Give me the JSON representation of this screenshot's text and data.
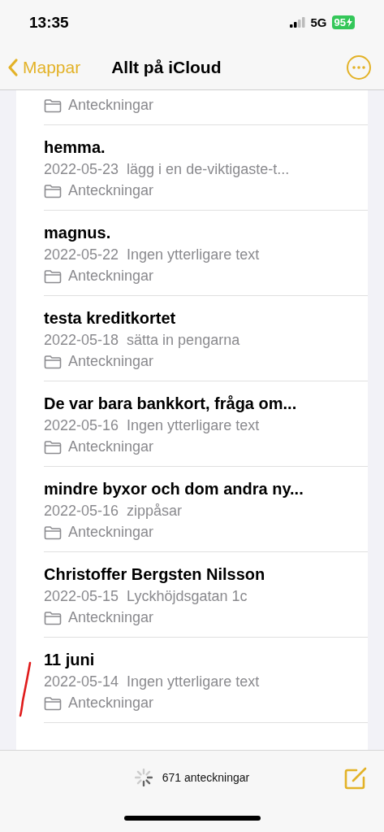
{
  "status_bar": {
    "time": "13:35",
    "network": "5G",
    "battery": "95"
  },
  "nav": {
    "back": "Mappar",
    "title": "Allt på iCloud"
  },
  "notes": [
    {
      "kind": "partial",
      "folder": "Anteckningar"
    },
    {
      "kind": "note",
      "title": "hemma.",
      "date": "2022-05-23",
      "snippet": "lägg i en de-viktigaste-t...",
      "folder": "Anteckningar"
    },
    {
      "kind": "note",
      "title": "magnus.",
      "date": "2022-05-22",
      "snippet": "Ingen ytterligare text",
      "folder": "Anteckningar"
    },
    {
      "kind": "note",
      "title": "testa kreditkortet",
      "date": "2022-05-18",
      "snippet": "sätta in pengarna",
      "folder": "Anteckningar"
    },
    {
      "kind": "note",
      "title": "De var bara bankkort, fråga om...",
      "date": "2022-05-16",
      "snippet": "Ingen ytterligare text",
      "folder": "Anteckningar"
    },
    {
      "kind": "note",
      "title": "mindre byxor och dom andra ny...",
      "date": "2022-05-16",
      "snippet": "zippåsar",
      "folder": "Anteckningar"
    },
    {
      "kind": "note",
      "title": "Christoffer Bergsten Nilsson",
      "date": "2022-05-15",
      "snippet": "Lyckhöjdsgatan 1c",
      "folder": "Anteckningar"
    },
    {
      "kind": "note",
      "title": "11 juni",
      "date": "2022-05-14",
      "snippet": "Ingen ytterligare text",
      "folder": "Anteckningar"
    }
  ],
  "toolbar": {
    "count": "671 anteckningar"
  }
}
